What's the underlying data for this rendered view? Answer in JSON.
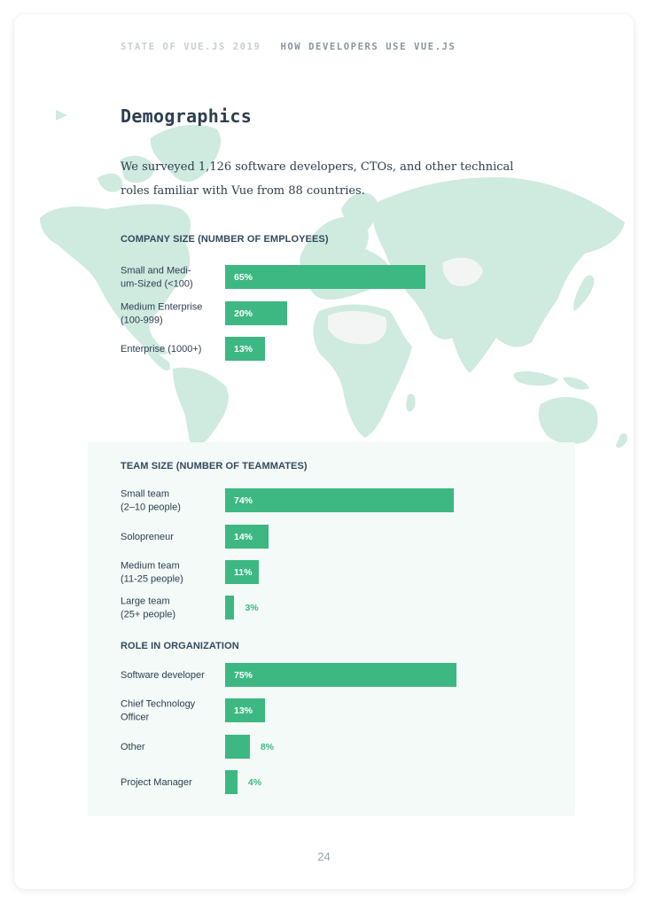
{
  "header": {
    "series": "STATE OF VUE.JS 2019",
    "chapter": "HOW DEVELOPERS USE VUE.JS"
  },
  "section": {
    "title": "Demographics",
    "intro": "We surveyed 1,126 software developers, CTOs, and other technical roles familiar with Vue from 88 countries."
  },
  "colors": {
    "bar": "#3db882",
    "map_land": "#cfeadf",
    "heading_text": "#2c3e50",
    "panel_bg": "#f3faf7"
  },
  "chart_data": [
    {
      "type": "bar",
      "orientation": "horizontal",
      "title": "COMPANY SIZE (NUMBER OF EMPLOYEES)",
      "categories": [
        "Small and Medi-um-Sized (<100)",
        "Medium Enterprise (100-999)",
        "Enterprise (1000+)"
      ],
      "category_lines": [
        [
          "Small and Medi-",
          "um-Sized (<100)"
        ],
        [
          "Medium Enterprise",
          "(100-999)"
        ],
        [
          "Enterprise (1000+)"
        ]
      ],
      "values": [
        65,
        20,
        13
      ],
      "labels": [
        "65%",
        "20%",
        "13%"
      ],
      "unit": "%",
      "xlim": [
        0,
        100
      ]
    },
    {
      "type": "bar",
      "orientation": "horizontal",
      "title": "TEAM SIZE (NUMBER OF TEAMMATES)",
      "categories": [
        "Small team (2–10 people)",
        "Solopreneur",
        "Medium team (11-25 people)",
        "Large team (25+ people)"
      ],
      "category_lines": [
        [
          "Small team",
          "(2–10 people)"
        ],
        [
          "Solopreneur"
        ],
        [
          "Medium team",
          "(11-25 people)"
        ],
        [
          "Large team",
          "(25+ people)"
        ]
      ],
      "values": [
        74,
        14,
        11,
        3
      ],
      "labels": [
        "74%",
        "14%",
        "11%",
        "3%"
      ],
      "unit": "%",
      "xlim": [
        0,
        100
      ]
    },
    {
      "type": "bar",
      "orientation": "horizontal",
      "title": "ROLE IN ORGANIZATION",
      "categories": [
        "Software developer",
        "Chief Technology Officer",
        "Other",
        "Project Manager"
      ],
      "category_lines": [
        [
          "Software developer"
        ],
        [
          "Chief Technology",
          "Officer"
        ],
        [
          "Other"
        ],
        [
          "Project Manager"
        ]
      ],
      "values": [
        75,
        13,
        8,
        4
      ],
      "labels": [
        "75%",
        "13%",
        "8%",
        "4%"
      ],
      "unit": "%",
      "xlim": [
        0,
        100
      ]
    }
  ],
  "footer": {
    "page_number": "24"
  }
}
